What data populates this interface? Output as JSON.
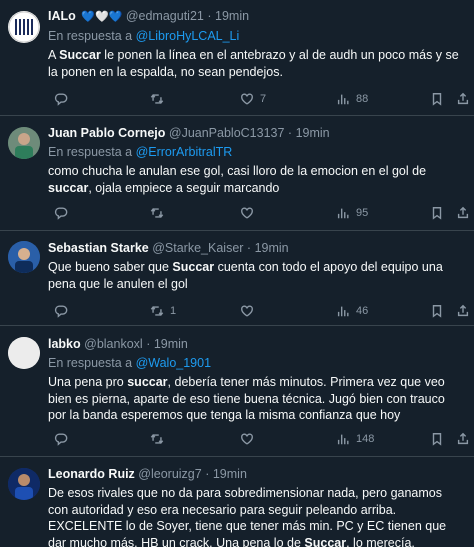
{
  "tweets": [
    {
      "name": "IALo",
      "badges": "💙🤍💙",
      "handle": "@edmaguti21",
      "time": "19min",
      "reply_prefix": "En respuesta a",
      "reply_to": "@LibroHyLCAL_Li",
      "text_html": "A <b>Succar</b> le ponen la línea en el antebrazo y al de audh un poco más y se la ponen en la espalda, no sean pendejos.",
      "replies": "",
      "retweets": "",
      "likes": "7",
      "views": "88"
    },
    {
      "name": "Juan Pablo Cornejo",
      "handle": "@JuanPabloC13137",
      "time": "19min",
      "reply_prefix": "En respuesta a",
      "reply_to": "@ErrorArbitralTR",
      "text_html": "como chucha le anulan ese gol, casi lloro de la emocion en el gol de <b>succar</b>, ojala empiece a seguir marcando",
      "replies": "",
      "retweets": "",
      "likes": "",
      "views": "95"
    },
    {
      "name": "Sebastian Starke",
      "handle": "@Starke_Kaiser",
      "time": "19min",
      "text_html": "Que bueno saber que <b>Succar</b> cuenta con todo el apoyo del equipo una pena que le anulen el gol",
      "replies": "",
      "retweets": "1",
      "likes": "",
      "views": "46"
    },
    {
      "name": "labko",
      "handle": "@blankoxl",
      "time": "19min",
      "reply_prefix": "En respuesta a",
      "reply_to": "@Walo_1901",
      "text_html": "Una pena pro <b>succar</b>, debería tener más minutos. Primera vez que veo bien es pierna, aparte de eso tiene buena técnica. Jugó bien con trauco por la banda esperemos que tenga la misma confianza que hoy",
      "replies": "",
      "retweets": "",
      "likes": "",
      "views": "148"
    },
    {
      "name": "Leonardo Ruiz",
      "handle": "@leoruizg7",
      "time": "19min",
      "text_html": "De esos rivales que no da para sobredimensionar nada, pero ganamos con autoridad y eso era necesario para seguir peleando arriba. EXCELENTE lo de Soyer, tiene que tener más min. PC y EC tienen que dar mucho más. HB un crack. Una pena lo de <b>Succar</b>, lo merecía. <span class=\"mention\">#ArribaAlianza</span> 💙💪🏾",
      "replies": "",
      "retweets": "",
      "likes": "",
      "views": ""
    }
  ],
  "colors": {
    "background": "#15202b",
    "text": "#f7f9f9",
    "muted": "#8b98a5",
    "link": "#1d9bf0",
    "divider": "#38444d"
  },
  "icons": [
    "reply-icon",
    "retweet-icon",
    "like-icon",
    "views-icon",
    "bookmark-icon",
    "share-icon"
  ]
}
